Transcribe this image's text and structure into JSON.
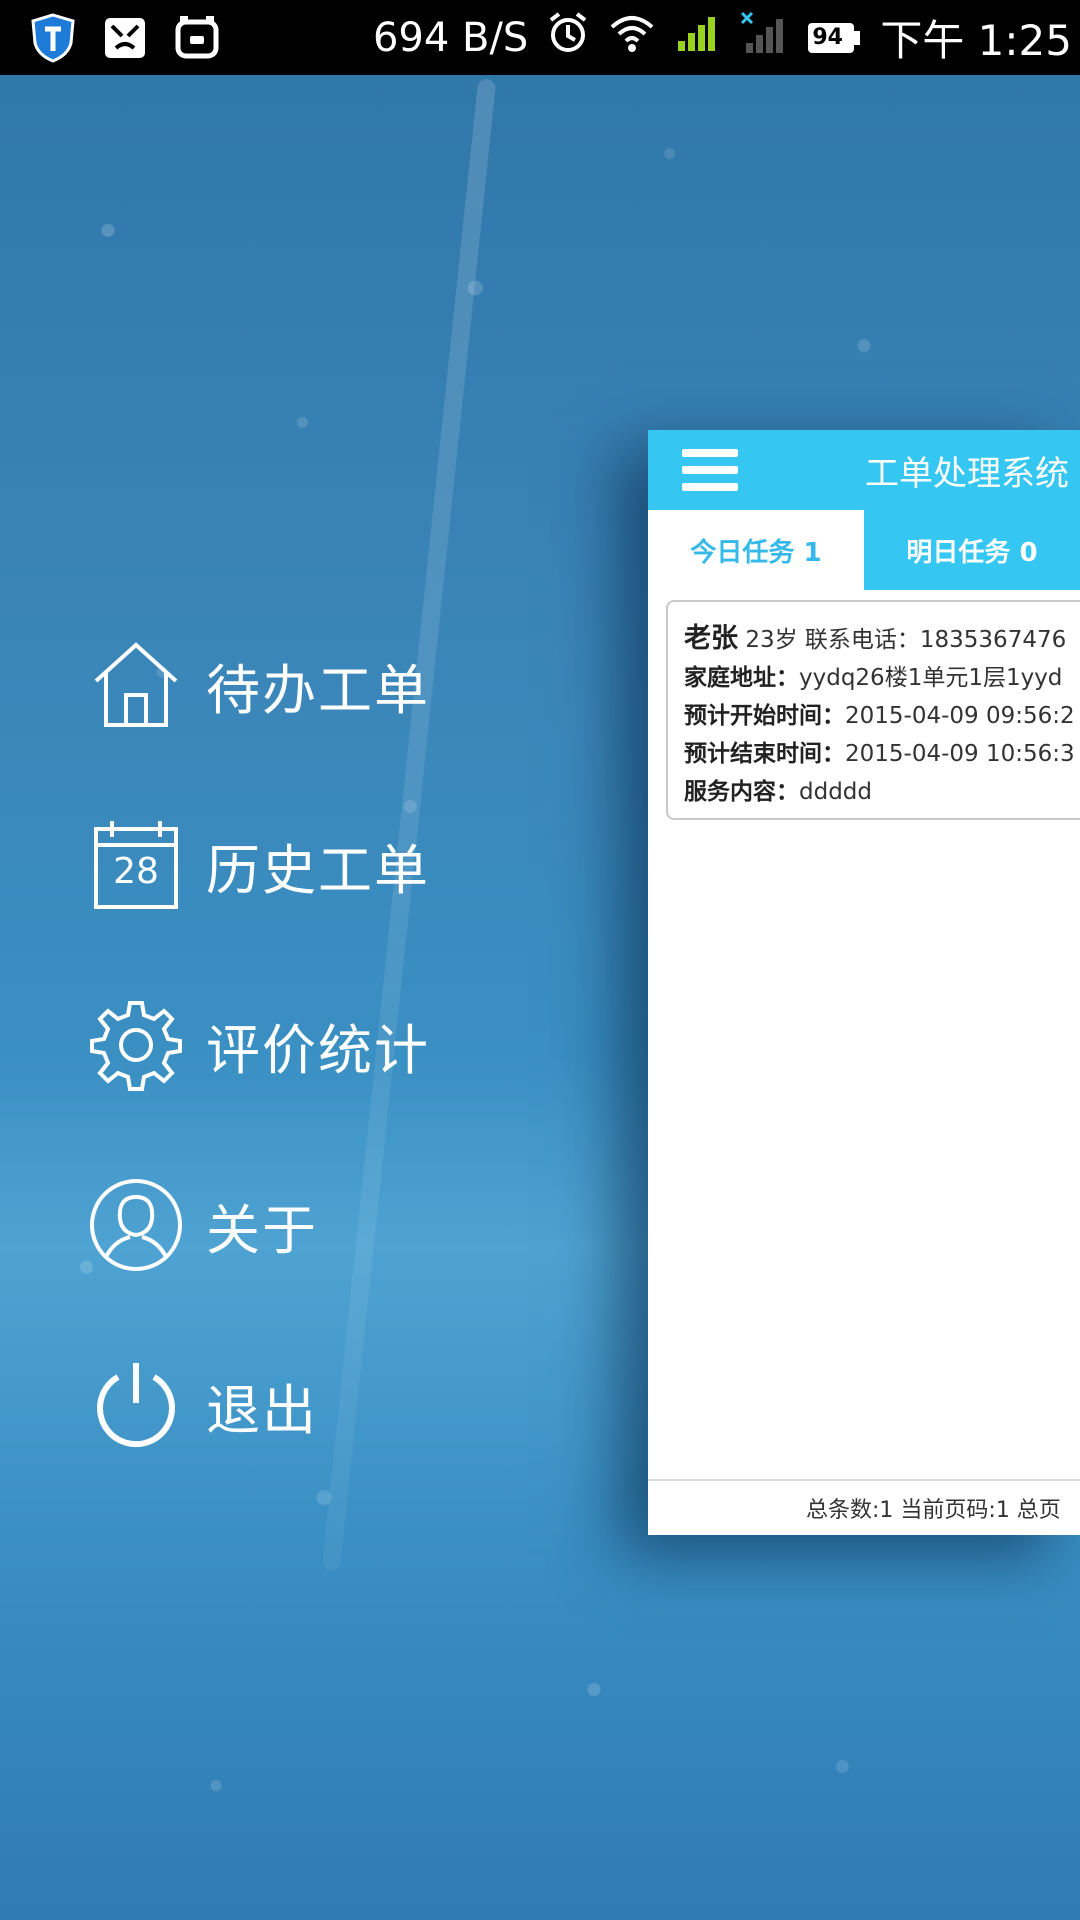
{
  "status_bar": {
    "icons_left": [
      "shield-icon",
      "bear-icon",
      "pig-icon"
    ],
    "net_speed": "694 B/S",
    "battery": "94",
    "time": "下午 1:25"
  },
  "menu": {
    "items": [
      {
        "icon": "home-icon",
        "label": "待办工单"
      },
      {
        "icon": "calendar-icon",
        "label": "历史工单",
        "calendar_day": "28"
      },
      {
        "icon": "gear-icon",
        "label": "评价统计"
      },
      {
        "icon": "user-icon",
        "label": "关于"
      },
      {
        "icon": "power-icon",
        "label": "退出"
      }
    ]
  },
  "panel": {
    "title": "工单处理系统",
    "tabs": [
      {
        "label": "今日任务 1",
        "active": true
      },
      {
        "label": "明日任务 0",
        "active": false
      }
    ],
    "card": {
      "name": "老张",
      "info": "23岁 联系电话：1835367476",
      "address_label": "家庭地址：",
      "address": "yydq26楼1单元1层1yyd",
      "start_label": "预计开始时间：",
      "start": "2015-04-09 09:56:2",
      "end_label": "预计结束时间：",
      "end": "2015-04-09 10:56:3",
      "content_label": "服务内容：",
      "content": "ddddd"
    },
    "footer": "总条数:1 当前页码:1 总页"
  },
  "colors": {
    "accent": "#35c6f2",
    "active_tab_text": "#35b9e8"
  }
}
